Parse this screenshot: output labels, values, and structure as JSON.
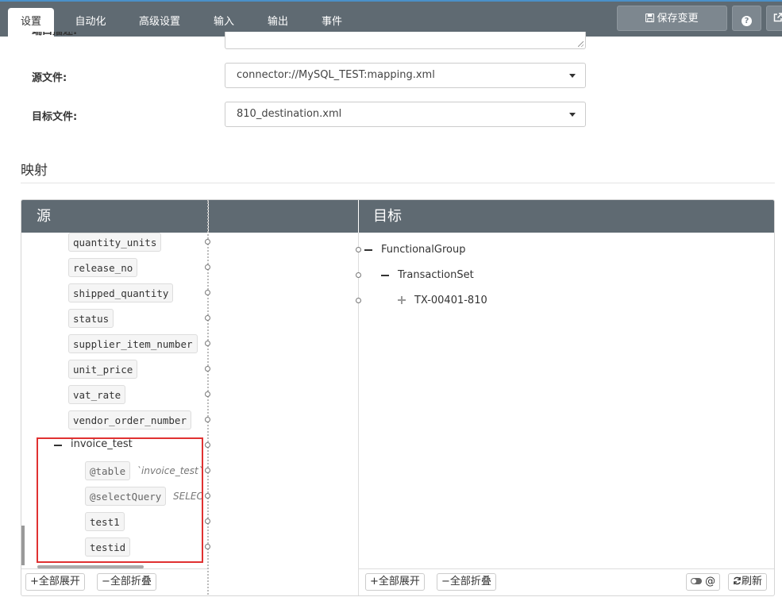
{
  "tabs": [
    {
      "label": "设置",
      "active": true
    },
    {
      "label": "自动化"
    },
    {
      "label": "高级设置"
    },
    {
      "label": "输入"
    },
    {
      "label": "输出"
    },
    {
      "label": "事件"
    }
  ],
  "toolbar": {
    "save_label": "保存变更",
    "help_label": "?"
  },
  "form": {
    "port_desc_label": "端口描述:",
    "source_label": "源文件:",
    "source_value": "connector://MySQL_TEST:mapping.xml",
    "target_label": "目标文件:",
    "target_value": "810_destination.xml"
  },
  "mapping": {
    "section_title": "映射",
    "source_header": "源",
    "target_header": "目标",
    "source_fields": [
      "quantity_units",
      "release_no",
      "shipped_quantity",
      "status",
      "supplier_item_number",
      "unit_price",
      "vat_rate",
      "vendor_order_number"
    ],
    "group": {
      "name": "invoice_test",
      "table_attr": "@table",
      "table_value": "`invoice_test`",
      "query_attr": "@selectQuery",
      "query_value": "SELEC",
      "children": [
        "test1",
        "testid"
      ]
    },
    "target_nodes": [
      "FunctionalGroup",
      "TransactionSet",
      "TX-00401-810"
    ],
    "expand_all": "全部展开",
    "collapse_all": "全部折叠",
    "at_label": "@",
    "refresh": "刷新"
  },
  "colors": {
    "header": "#5f6a72",
    "highlight": "#e03131"
  }
}
